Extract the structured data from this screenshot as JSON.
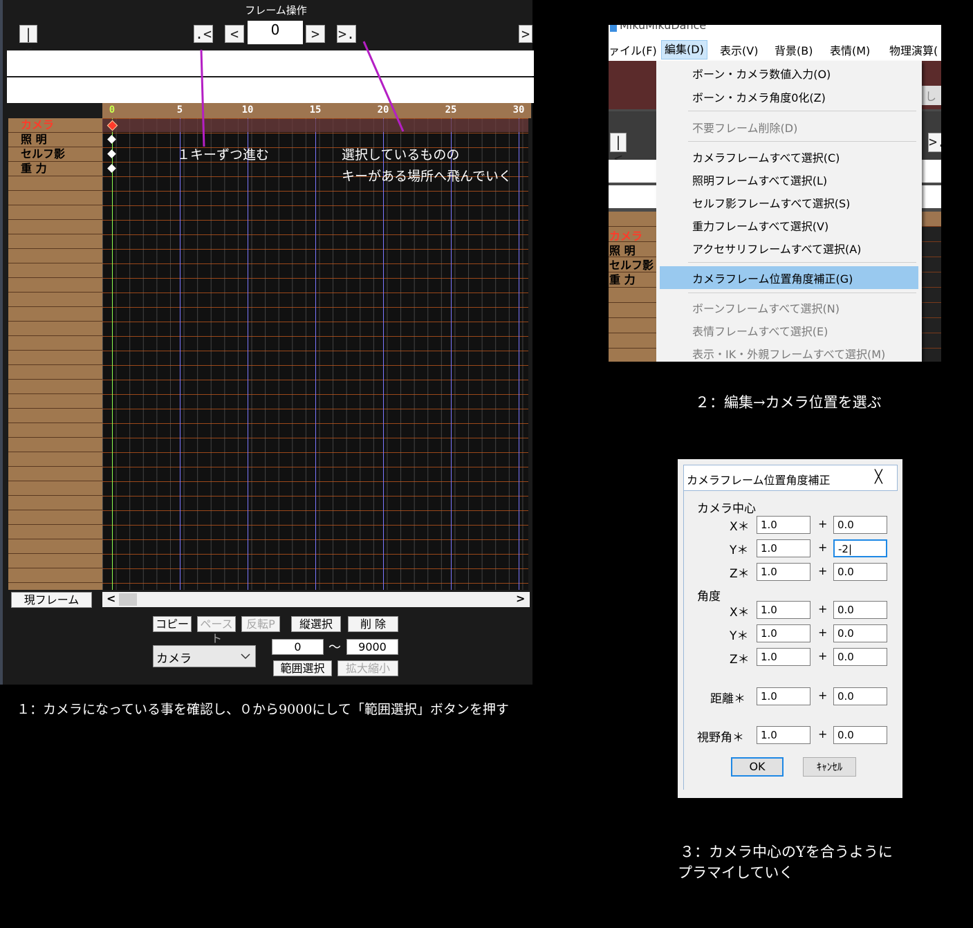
{
  "panel1": {
    "title": "フレーム操作",
    "nav": {
      "first": "|<",
      "prev_key": ".<",
      "prev": "<",
      "frame_value": "0",
      "next": ">",
      "next_key": ">.",
      "last": ">"
    },
    "ruler_ticks": [
      "0",
      "5",
      "10",
      "15",
      "20",
      "25",
      "30"
    ],
    "rows": [
      "カメラ",
      "照 明",
      "セルフ影",
      "重 力"
    ],
    "annotation_left": "１キーずつ進む",
    "annotation_right": [
      "選択しているものの",
      "キーがある場所へ飛んでいく"
    ],
    "current_frame_button": "現フレーム",
    "scroll_left": "<",
    "scroll_right": ">",
    "buttons": {
      "copy": "コピー",
      "paste": "ペースト",
      "reverse_paste": "反転P",
      "vertical_select": "縦選択",
      "delete": "削 除",
      "range_select": "範囲選択",
      "zoom": "拡大縮小"
    },
    "target_select": "カメラ",
    "range_from": "0",
    "range_tilde": "～",
    "range_to": "9000",
    "caption": "１：カメラになっている事を確認し、０から9000にして「範囲選択」ボタンを押す"
  },
  "panel2": {
    "window_title": "MikuMikuDance",
    "menubar": [
      "ァイル(F)",
      "編集(D)",
      "表示(V)",
      "背景(B)",
      "表情(M)",
      "物理演算("
    ],
    "bg_buttons": {
      "first": "|<",
      "next_key": ">."
    },
    "bg_rows": [
      "カメラ",
      "照 明",
      "セルフ影",
      "重 力"
    ],
    "bg_text": "し",
    "items": [
      {
        "label": "ボーン・カメラ数値入力(O)",
        "enabled": true
      },
      {
        "label": "ボーン・カメラ角度0化(Z)",
        "enabled": true
      },
      {
        "label": "不要フレーム削除(D)",
        "enabled": false
      },
      {
        "label": "カメラフレームすべて選択(C)",
        "enabled": true
      },
      {
        "label": "照明フレームすべて選択(L)",
        "enabled": true
      },
      {
        "label": "セルフ影フレームすべて選択(S)",
        "enabled": true
      },
      {
        "label": "重力フレームすべて選択(V)",
        "enabled": true
      },
      {
        "label": "アクセサリフレームすべて選択(A)",
        "enabled": true
      },
      {
        "label": "カメラフレーム位置角度補正(G)",
        "enabled": true,
        "highlighted": true
      },
      {
        "label": "ボーンフレームすべて選択(N)",
        "enabled": false
      },
      {
        "label": "表情フレームすべて選択(E)",
        "enabled": false
      },
      {
        "label": "表示・IK・外親フレームすべて選択(M)",
        "enabled": false
      }
    ],
    "caption": "２：編集→カメラ位置を選ぶ",
    "highlight_color": "#99c9ef"
  },
  "panel3": {
    "title": "カメラフレーム位置角度補正",
    "close": "╳",
    "section_center": "カメラ中心",
    "section_angle": "角度",
    "center": [
      {
        "axis": "X＊",
        "mul": "1.0",
        "plus": "+",
        "add": "0.0"
      },
      {
        "axis": "Y＊",
        "mul": "1.0",
        "plus": "+",
        "add": "-2|"
      },
      {
        "axis": "Z＊",
        "mul": "1.0",
        "plus": "+",
        "add": "0.0"
      }
    ],
    "angle": [
      {
        "axis": "X＊",
        "mul": "1.0",
        "plus": "+",
        "add": "0.0"
      },
      {
        "axis": "Y＊",
        "mul": "1.0",
        "plus": "+",
        "add": "0.0"
      },
      {
        "axis": "Z＊",
        "mul": "1.0",
        "plus": "+",
        "add": "0.0"
      }
    ],
    "distance": {
      "label": "距離＊",
      "mul": "1.0",
      "plus": "+",
      "add": "0.0"
    },
    "fov": {
      "label": "視野角＊",
      "mul": "1.0",
      "plus": "+",
      "add": "0.0"
    },
    "ok": "OK",
    "cancel": "ｷｬﾝｾﾙ",
    "caption": [
      "３：カメラ中心のYを合うように",
      "プラマイしていく"
    ]
  },
  "colors": {
    "annotation_line": "#b41fc4",
    "focus": "#1e88e5"
  }
}
